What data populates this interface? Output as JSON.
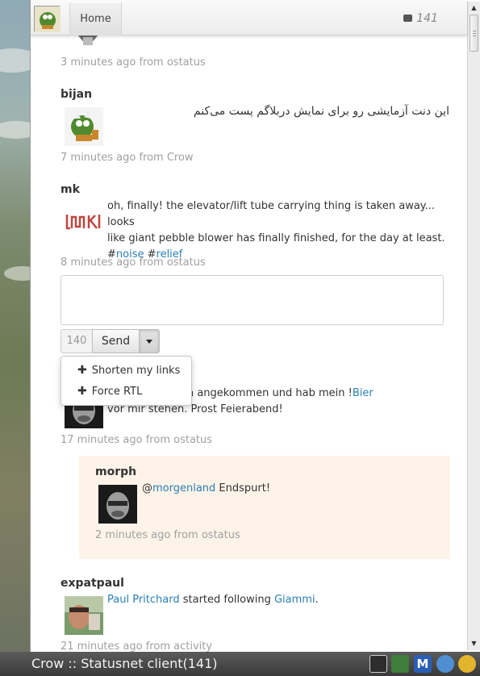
{
  "header": {
    "home_label": "Home",
    "notification_count": "141"
  },
  "feed": {
    "items": [
      {
        "user": "",
        "text": "",
        "meta": "3 minutes ago from ostatus"
      },
      {
        "user": "bijan",
        "text": "این دنت آزمایشی رو برای نمایش دربلاگم پست می‌کنم",
        "meta": "7 minutes ago from Crow"
      },
      {
        "user": "mk",
        "text_line1": "oh, finally! the elevator/lift tube carrying thing is taken away... looks",
        "text_line2": "like giant pebble blower has finally finished, for the day at least.",
        "hashtag_prefix1": "#",
        "tag1": "noise",
        "hashtag_prefix2": " #",
        "tag2": "relief",
        "meta": "8 minutes ago from ostatus"
      },
      {
        "user": "",
        "text_part1": "m bin gerade da angekommen und hab mein !",
        "link": "Bier",
        "text_line2": "vor mir stehen. Prost Feierabend!",
        "meta": "17 minutes ago from ostatus"
      },
      {
        "user": "expatpaul",
        "link_user": "Paul Pritchard",
        "action": " started following ",
        "link_target": "Giammi",
        "period": ".",
        "meta": "21 minutes ago from activity"
      }
    ],
    "reply": {
      "user": "morph",
      "mention_prefix": "@",
      "mention": "morgenland",
      "text": " Endspurt!",
      "meta": "2 minutes ago from ostatus"
    }
  },
  "compose": {
    "char_count": "140",
    "send_label": "Send",
    "menu": [
      "Shorten my links",
      "Force RTL"
    ]
  },
  "taskbar": {
    "title": "Crow :: Statusnet client(141)"
  },
  "colors": {
    "link": "#2a7fb8",
    "meta": "#a0a0a0",
    "reply_bg": "#fdf3e8"
  }
}
